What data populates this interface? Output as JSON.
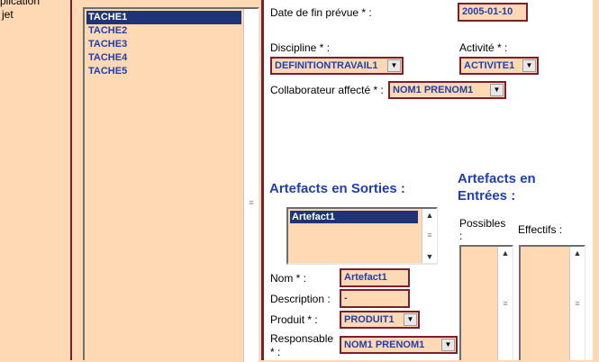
{
  "left_nav": {
    "items": [
      "plication",
      "jet"
    ]
  },
  "tasks": {
    "items": [
      "TACHE1",
      "TACHE2",
      "TACHE3",
      "TACHE4",
      "TACHE5"
    ],
    "selected_index": 0
  },
  "form": {
    "date_fin_label": "Date de fin prévue * :",
    "date_fin_value": "2005-01-10",
    "discipline_label": "Discipline * :",
    "discipline_value": "DEFINITIONTRAVAIL1",
    "activite_label": "Activité * :",
    "activite_value": "ACTIVITE1",
    "collab_label": "Collaborateur affecté * :",
    "collab_value": "NOM1  PRENOM1"
  },
  "sorties": {
    "heading": "Artefacts en Sorties :",
    "items": [
      "Artefact1"
    ],
    "nom_label": "Nom * :",
    "nom_value": "Artefact1",
    "description_label": "Description :",
    "description_value": "-",
    "produit_label": "Produit * :",
    "produit_value": "PRODUIT1",
    "responsable_label_1": "Responsable",
    "responsable_label_2": "* :",
    "responsable_value": "NOM1  PRENOM1"
  },
  "entrees": {
    "heading_1": "Artefacts en",
    "heading_2": "Entrées :",
    "possibles_label_1": "Possibles",
    "possibles_label_2": ":",
    "effectifs_label": "Effectifs :"
  },
  "colors": {
    "background": "#ffd9b3",
    "accent": "#1f3fae",
    "border": "#7a1f2b",
    "selection": "#1f3476"
  },
  "icons": {
    "dropdown": "chevron-down-icon",
    "scroll_up": "arrow-up-icon",
    "scroll_down": "arrow-down-icon",
    "scroll_grip": "grip-icon"
  }
}
